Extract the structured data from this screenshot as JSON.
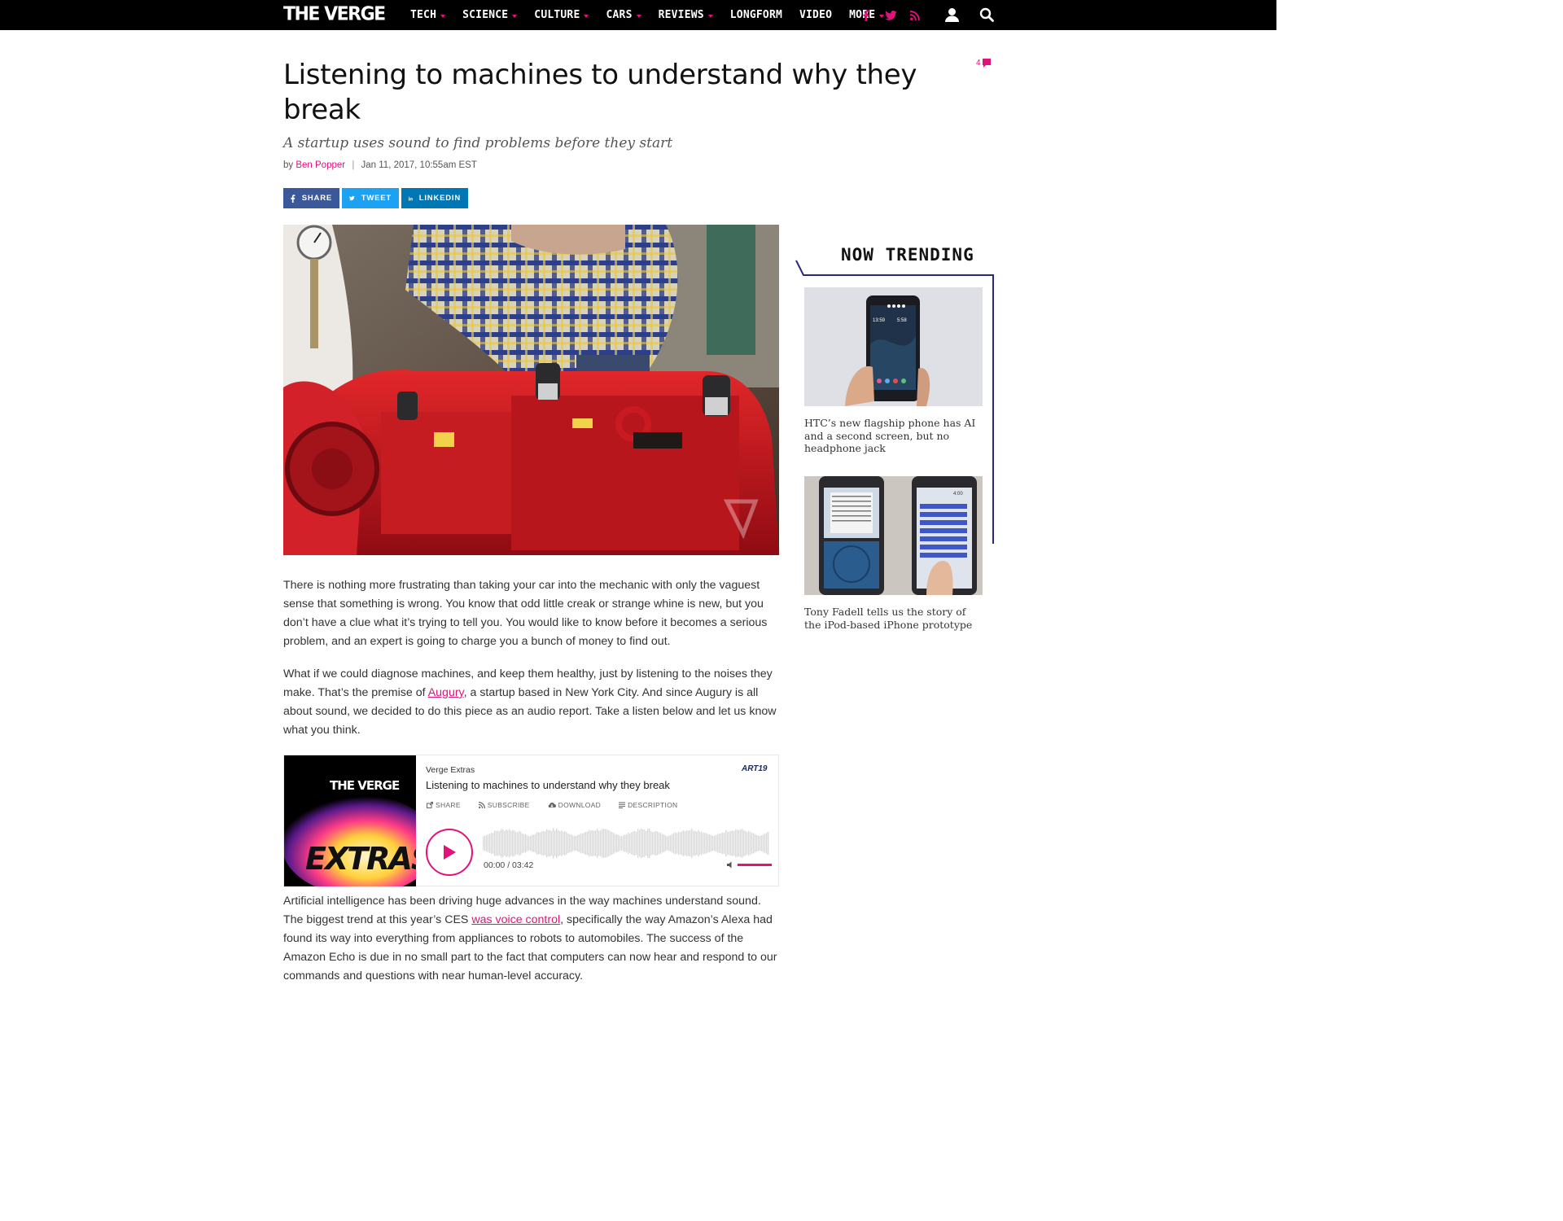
{
  "nav": {
    "logo": "THE VERGE",
    "items": [
      {
        "label": "TECH",
        "dropdown": true
      },
      {
        "label": "SCIENCE",
        "dropdown": true
      },
      {
        "label": "CULTURE",
        "dropdown": true
      },
      {
        "label": "CARS",
        "dropdown": true
      },
      {
        "label": "REVIEWS",
        "dropdown": true
      },
      {
        "label": "LONGFORM",
        "dropdown": false
      },
      {
        "label": "VIDEO",
        "dropdown": false
      },
      {
        "label": "MORE",
        "dropdown": true
      }
    ],
    "social_icons": [
      "facebook-icon",
      "twitter-icon",
      "rss-icon"
    ],
    "accent_color": "#e2127a"
  },
  "article": {
    "headline": "Listening to machines to understand why they break",
    "comment_count": "4",
    "dek": "A startup uses sound to find problems before they start",
    "byline_prefix": "by",
    "author": "Ben Popper",
    "byline_separator": "|",
    "date": "Jan 11, 2017, 10:55am EST",
    "share": {
      "facebook": "SHARE",
      "twitter": "TWEET",
      "linkedin": "LINKEDIN"
    },
    "paragraph1": "There is nothing more frustrating than taking your car into the mechanic with only the vaguest sense that something is wrong. You know that odd little creak or strange whine is new, but you don’t have a clue what it’s trying to tell you. You would like to know before it becomes a serious problem, and an expert is going to charge you a bunch of money to find out.",
    "paragraph2": {
      "before": "What if we could diagnose machines, and keep them healthy, just by listening to the noises they make. That’s the premise of ",
      "link": "Augury",
      "after": ", a startup based in New York City. And since Augury is all about sound, we decided to do this piece as an audio report. Take a listen below and let us know what you think."
    },
    "paragraph3": {
      "before": "Artificial intelligence has been driving huge advances in the way machines understand sound. The biggest trend at this year’s CES ",
      "link": "was voice control",
      "after": ", specifically the way Amazon’s Alexa had found its way into everything from appliances to robots to automobiles. The success of the Amazon Echo is due in no small part to the fact that computers can now hear and respond to our commands and questions with near human-level accuracy."
    }
  },
  "player": {
    "art_logo": "THE VERGE",
    "art_title": "EXTRAS",
    "show": "Verge Extras",
    "title": "Listening to machines to understand why they break",
    "brand": "ART19",
    "links": [
      "SHARE",
      "SUBSCRIBE",
      "DOWNLOAD",
      "DESCRIPTION"
    ],
    "time": "00:00 / 03:42",
    "progress": 0
  },
  "sidebar": {
    "title": "NOW TRENDING",
    "items": [
      {
        "caption": "HTC’s new flagship phone has AI and a second screen, but no headphone jack",
        "screen_time1": "13:59",
        "screen_time2": "5:58"
      },
      {
        "caption": "Tony Fadell tells us the story of the iPod-based iPhone prototype",
        "screen_time": "4:00"
      }
    ]
  }
}
